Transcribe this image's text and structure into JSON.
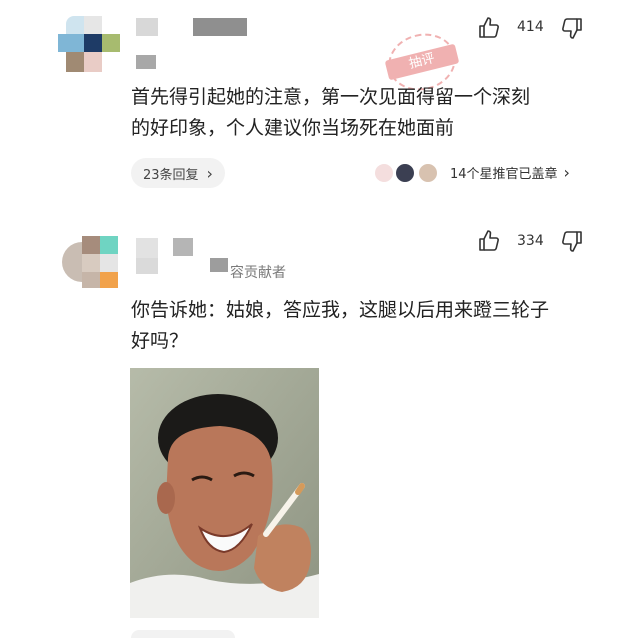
{
  "comments": [
    {
      "likes": "414",
      "text_lines": [
        "首先得引起她的注意，第一次见面得留一个深刻",
        "的好印象，个人建议你当场死在她面前"
      ],
      "replies": {
        "label": "23条回复",
        "arrow": "›"
      },
      "endorsement": {
        "label": "14个星推官已盖章",
        "arrow": "›"
      },
      "stamp": "抽评"
    },
    {
      "likes": "334",
      "badge": "容贡献者",
      "text_lines": [
        "你告诉她：姑娘，答应我，这腿以后用来蹬三轮子",
        "好吗？"
      ]
    }
  ],
  "icons": {
    "like": "thumbs-up-icon",
    "dislike": "thumbs-down-icon"
  },
  "colors": {
    "stamp": "#e57373",
    "pill_bg": "#f2f2f2"
  }
}
